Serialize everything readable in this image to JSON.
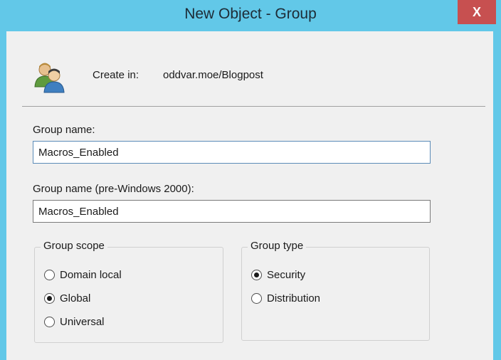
{
  "window": {
    "title": "New Object - Group",
    "close_label": "X"
  },
  "header": {
    "icon": "group-users-icon",
    "create_in_label": "Create in:",
    "create_in_value": "oddvar.moe/Blogpost"
  },
  "form": {
    "group_name_label": "Group name:",
    "group_name_value": "Macros_Enabled",
    "group_name_pre2000_label": "Group name (pre-Windows 2000):",
    "group_name_pre2000_value": "Macros_Enabled"
  },
  "group_scope": {
    "title": "Group scope",
    "options": [
      {
        "label": "Domain local",
        "checked": false
      },
      {
        "label": "Global",
        "checked": true
      },
      {
        "label": "Universal",
        "checked": false
      }
    ]
  },
  "group_type": {
    "title": "Group type",
    "options": [
      {
        "label": "Security",
        "checked": true
      },
      {
        "label": "Distribution",
        "checked": false
      }
    ]
  },
  "colors": {
    "title_bar": "#62c8e8",
    "close_button": "#c75050",
    "dialog_background": "#f0f0f0"
  }
}
